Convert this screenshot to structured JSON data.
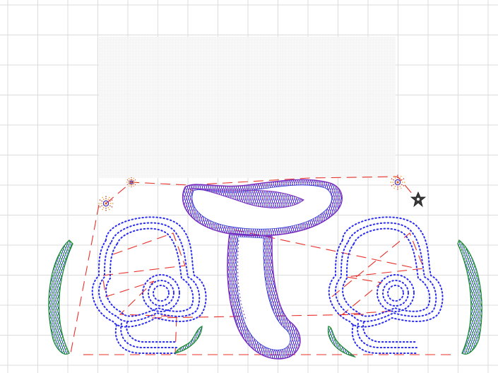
{
  "canvas": {
    "background": "#ffffff",
    "grid_color": "#dcdcdc",
    "hoop_fill": "#f4f4f4",
    "travel_color": "#e8302a",
    "satin_purple": "#7a2fbf",
    "satin_blue": "#2e3bd6",
    "satin_green": "#1f8a3a",
    "run_blue": "#2a2cf0",
    "star_orange": "#f09a20",
    "star_red": "#c03020",
    "needle_color": "#3a3a3a"
  },
  "design": {
    "objects": [
      {
        "name": "mushroom-cap",
        "stitch": "satin"
      },
      {
        "name": "mushroom-stem",
        "stitch": "satin"
      },
      {
        "name": "left-mushroom-outline",
        "stitch": "running"
      },
      {
        "name": "right-mushroom-outline",
        "stitch": "running"
      },
      {
        "name": "left-leaf",
        "stitch": "satin"
      },
      {
        "name": "right-leaf",
        "stitch": "satin"
      },
      {
        "name": "left-grass-tuft",
        "stitch": "satin"
      },
      {
        "name": "right-grass-tuft",
        "stitch": "satin"
      },
      {
        "name": "sparkle-left-large",
        "stitch": "star"
      },
      {
        "name": "sparkle-left-small",
        "stitch": "star"
      },
      {
        "name": "sparkle-right",
        "stitch": "star"
      }
    ],
    "needle_icon": "needle-position-icon"
  }
}
